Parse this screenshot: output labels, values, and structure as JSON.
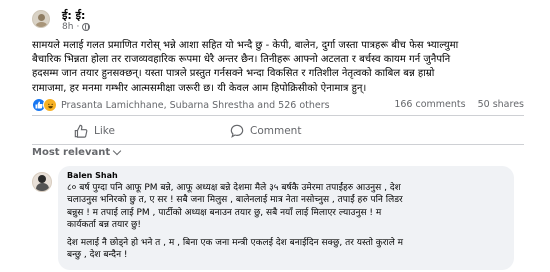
{
  "post": {
    "author_name": "ई: ई:",
    "timestamp": "8h",
    "privacy_icon": "globe-icon",
    "body_lines": [
      "सामयले मलाई गलत प्रमाणित गरोस् भन्ने आशा सहित यो भन्दै छु - केपी, बालेन, दुर्गा जस्ता पात्रहरू बीच फेस भ्याल्युमा",
      "बैचारिक भिन्नता होला तर राजव्यवहारिक रूपमा धेरै अन्तर छैन। तिनीहरू आफ्नो अटलता र बर्चस्व कायम गर्न जुनैपनि",
      "हदसम्म जान तयार हुनसक्छन्। यस्ता पात्रले प्रस्तुत गर्नसक्ने भन्दा विकसित र गतिशील नेतृत्वको काबिल बन्न हाम्रो",
      "रामाजमा, हर मनमा गम्भीर आत्मसमीक्षा जरूरी छ। यी केवल आम हिपोक्रिसीको ऐनामात्र हुन्।"
    ],
    "reactions": {
      "icons": [
        "like-reaction-icon",
        "haha-reaction-icon"
      ],
      "reactors_text": "Prasanta Lamichhane, Subarna Shrestha and 526 others"
    },
    "comments_count": "166 comments",
    "shares_count": "50 shares"
  },
  "actions": {
    "like_label": "Like",
    "comment_label": "Comment"
  },
  "sort": {
    "label": "Most relevant"
  },
  "comment": {
    "author": "Balen Shah",
    "lines": [
      "८० बर्ष पुग्दा पनि आफू PM बन्ने, आफू अध्यक्ष बन्ने देशमा मैले ३५ बर्षकै उमेरमा तपाईंहरु आउनुस , देश",
      "चलाउनुस भनिरको छु त, ए सर ! सबै जना मिलुस , बालेनलाई मात्र नेता नसोच्नुस , तपाईं हरु पनि लिडर",
      "बन्नुस ! म तपाई लाई PM , पार्टीको अध्यक्ष बनाउन तयार छु, सबै नयाँ लाई मिलाएर ल्याउनुस ! म",
      "कार्यकर्ता बन्न तयार छु!",
      "देश मलाई नै छोड्ने हो भने त , म , बिना एक जना मन्त्री एकलई देश बनाईदिन सक्छु, तर यस्तो कुराले म",
      "बन्छु , देश बन्दैन !"
    ]
  },
  "colors": {
    "accent": "#1877f2",
    "muted_text": "#65676b",
    "comment_bubble": "#f0f2f5"
  }
}
